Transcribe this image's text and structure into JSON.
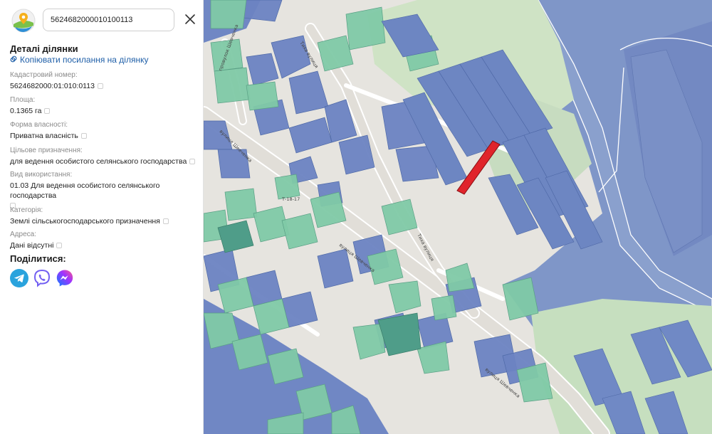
{
  "search": {
    "value": "5624682000010100113"
  },
  "details": {
    "title": "Деталі ділянки",
    "copy_link": "Копіювати посилання на ділянку",
    "fields": [
      {
        "label": "Кадастровий номер:",
        "value": "5624682000:01:010:0113"
      },
      {
        "label": "Площа:",
        "value": "0.1365 га"
      },
      {
        "label": "Форма власності:",
        "value": "Приватна власність"
      },
      {
        "label": "Цільове призначення:",
        "value": "для ведення особистого селянського господарства"
      },
      {
        "label": "Вид використання:",
        "value": "01.03 Для ведення особистого селянського господарства"
      },
      {
        "label": "Категорія:",
        "value": "Землі сільськогосподарського призначення"
      },
      {
        "label": "Адреса:",
        "value": "Дані відсутні"
      }
    ]
  },
  "share": {
    "title": "Поділитися:"
  },
  "icons": {
    "logo": "logo-icon",
    "close": "close-icon",
    "copy": "link-icon",
    "telegram": "telegram-icon",
    "viber": "viber-icon",
    "messenger": "messenger-icon"
  },
  "map": {
    "road_labels": {
      "r1": "вулиця Шевченка",
      "r2": "Т-18-17",
      "r3": "вулиця Шевченка",
      "r4": "вулиця Шевченка",
      "r5": "Тиха вулиця",
      "r6": "Тиха вулиця",
      "r7": "провулок Шевченка"
    },
    "colors": {
      "water": "#7d93c6",
      "parcel_blue": "#6f86c4",
      "parcel_green": "#7cc7a5",
      "parcel_darkgreen": "#4e9b86",
      "selected": "#e0242b",
      "roads": "#ffffff",
      "land": "#e8e6e2"
    }
  }
}
